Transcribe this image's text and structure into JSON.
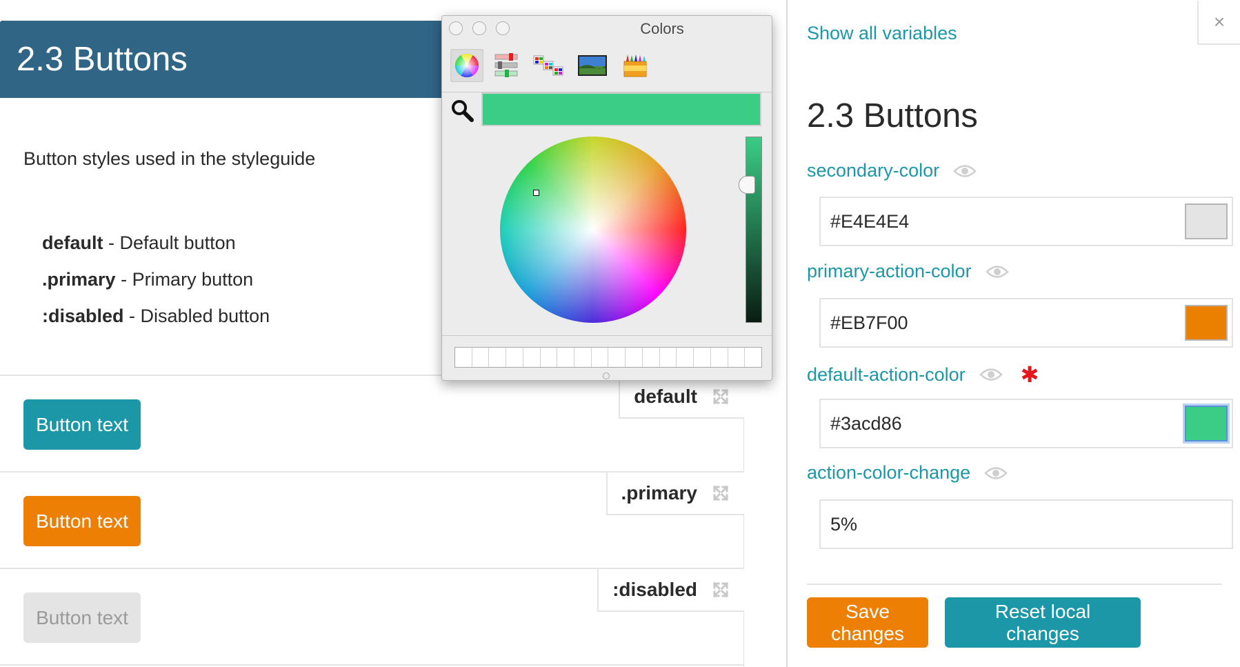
{
  "styleguide": {
    "section_title": "2.3 Buttons",
    "description": "Button styles used in the styleguide",
    "modifiers": [
      {
        "name": "default",
        "desc": "- Default button"
      },
      {
        "name": ".primary",
        "desc": "- Primary button"
      },
      {
        "name": ":disabled",
        "desc": "- Disabled button"
      }
    ],
    "examples": [
      {
        "tag": "default",
        "button_label": "Button text"
      },
      {
        "tag": ".primary",
        "button_label": "Button text"
      },
      {
        "tag": ":disabled",
        "button_label": "Button text"
      }
    ]
  },
  "colors_panel": {
    "title": "Colors",
    "current_color": "#3acd86",
    "tools": [
      "color-wheel-icon",
      "color-sliders-icon",
      "color-palettes-icon",
      "image-palettes-icon",
      "crayons-icon"
    ]
  },
  "variables_panel": {
    "show_all_label": "Show all variables",
    "close_label": "×",
    "title": "2.3 Buttons",
    "variables": [
      {
        "name": "secondary-color",
        "value": "#E4E4E4",
        "swatch": "#E4E4E4",
        "changed": false
      },
      {
        "name": "primary-action-color",
        "value": "#EB7F00",
        "swatch": "#EB7F00",
        "changed": false
      },
      {
        "name": "default-action-color",
        "value": "#3acd86",
        "swatch": "#3acd86",
        "changed": true,
        "changed_mark": "✱"
      },
      {
        "name": "action-color-change",
        "value": "5%",
        "changed": false
      }
    ],
    "save_label": "Save changes",
    "reset_label": "Reset local changes"
  },
  "colors": {
    "header_bg": "#306586",
    "accent_teal": "#1b97a8",
    "accent_orange": "#ed7f05",
    "disabled_bg": "#e4e4e4"
  }
}
